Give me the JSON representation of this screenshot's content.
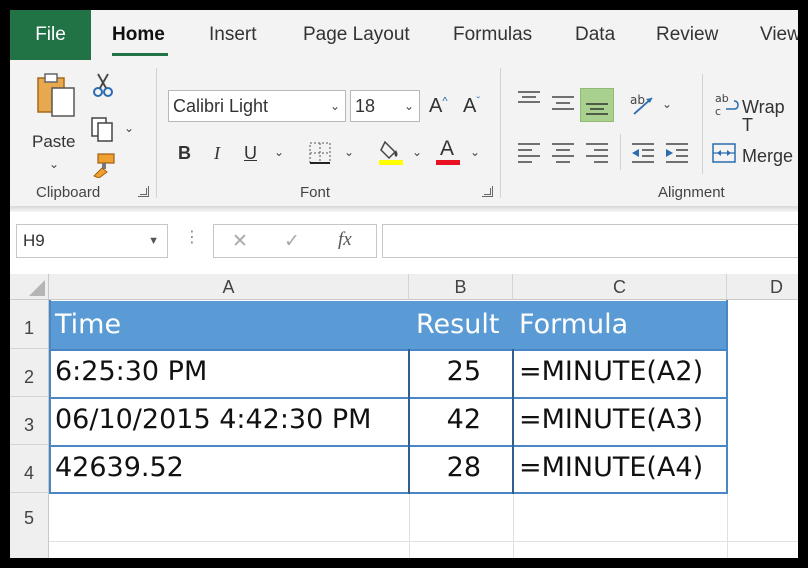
{
  "ribbon_tabs": [
    "File",
    "Home",
    "Insert",
    "Page Layout",
    "Formulas",
    "Data",
    "Review",
    "View"
  ],
  "clipboard": {
    "paste_label": "Paste",
    "group_label": "Clipboard"
  },
  "font": {
    "name": "Calibri Light",
    "size": "18",
    "group_label": "Font"
  },
  "alignment": {
    "wrap_label": "Wrap T",
    "merge_label": "Merge",
    "group_label": "Alignment"
  },
  "formula_bar": {
    "name_box": "H9",
    "cancel_symbol": "✕",
    "enter_symbol": "✓",
    "fx_symbol": "fx",
    "content": ""
  },
  "columns": [
    "A",
    "B",
    "C",
    "D"
  ],
  "rows": [
    "1",
    "2",
    "3",
    "4",
    "5"
  ],
  "table": {
    "headers": [
      "Time",
      "Result",
      "Formula"
    ],
    "data": [
      [
        "6:25:30 PM",
        "25",
        "=MINUTE(A2)"
      ],
      [
        "06/10/2015 4:42:30 PM",
        "42",
        "=MINUTE(A3)"
      ],
      [
        "42639.52",
        "28",
        "=MINUTE(A4)"
      ]
    ]
  },
  "colors": {
    "accent": "#217346",
    "table_header": "#5b9bd5",
    "font_color": "#e81123",
    "highlight": "#ffff00"
  },
  "icons": [
    "paste-icon",
    "cut-icon",
    "copy-icon",
    "format-painter-icon",
    "increase-font-icon",
    "decrease-font-icon",
    "bold-icon",
    "italic-icon",
    "underline-icon",
    "borders-icon",
    "fill-color-icon",
    "font-color-icon",
    "align-top-icon",
    "align-middle-icon",
    "align-bottom-icon",
    "orientation-icon",
    "wrap-text-icon",
    "align-left-icon",
    "align-center-icon",
    "align-right-icon",
    "decrease-indent-icon",
    "increase-indent-icon",
    "merge-icon"
  ]
}
